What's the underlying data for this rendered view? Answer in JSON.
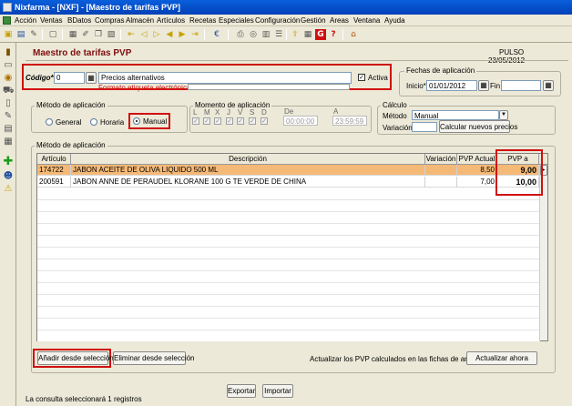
{
  "window": {
    "title": "Nixfarma - [NXF] - [Maestro de tarifas PVP]"
  },
  "menu": [
    "Acción",
    "Ventas",
    "BDatos",
    "Compras",
    "Almacén",
    "Artículos",
    "Recetas",
    "Especiales",
    "Configuración",
    "Gestión",
    "Areas",
    "Ventana",
    "Ayuda"
  ],
  "form": {
    "title": "Maestro de tarifas PVP",
    "company": "PULSO",
    "date": "23/05/2012",
    "codigo_label": "Código*",
    "codigo_value": "0",
    "descripcion_value": "Precios alternativos",
    "formato_label": "Formato etiqueta electrónica",
    "activa_label": "Activa",
    "activa_checked": "✓",
    "fechas_label": "Fechas de aplicación",
    "inicio_label": "Inicio*",
    "inicio_value": "01/01/2012",
    "fin_label": "Fin",
    "fin_value": ""
  },
  "metodo": {
    "label": "Método de aplicación",
    "options": [
      "General",
      "Horaria",
      "Manual"
    ],
    "selected": "Manual"
  },
  "momento": {
    "label": "Momento de aplicación",
    "days": [
      "L",
      "M",
      "X",
      "J",
      "V",
      "S",
      "D"
    ],
    "de_label": "De",
    "de_value": "00:00:00",
    "a_label": "A",
    "a_value": "23:59:59"
  },
  "calculo": {
    "label": "Cálculo",
    "metodo_label": "Método",
    "metodo_value": "Manual",
    "variacion_label": "Variación",
    "variacion_value": "",
    "calc_button": "Calcular nuevos precios"
  },
  "grid": {
    "section_label": "Método de aplicación",
    "headers": [
      "Artículo",
      "Descripción",
      "Variación",
      "PVP Actual",
      "PVP a Aplicar"
    ],
    "rows": [
      {
        "articulo": "174722",
        "descripcion": "JABON ACEITE DE OLIVA LIQUIDO 500 ML",
        "variacion": "",
        "pvp_actual": "8,50",
        "pvp_aplicar": "9,00"
      },
      {
        "articulo": "200591",
        "descripcion": "JABON ANNE DE PERAUDEL KLORANE 100 G TE VERDE DE CHINA",
        "variacion": "",
        "pvp_actual": "7,00",
        "pvp_aplicar": "10,00"
      }
    ]
  },
  "actions": {
    "add_button": "Añadir desde selección",
    "remove_button": "Eliminar desde selección",
    "update_text": "Actualizar los PVP calculados en las fichas de artículos",
    "update_button": "Actualizar ahora",
    "export_button": "Exportar",
    "import_button": "Importar"
  },
  "status": {
    "text": "La consulta seleccionará 1  registros"
  },
  "colors": {
    "selected_row": "#f5b977",
    "highlight": "#d01010",
    "title_blue": "#0a5fdc"
  }
}
